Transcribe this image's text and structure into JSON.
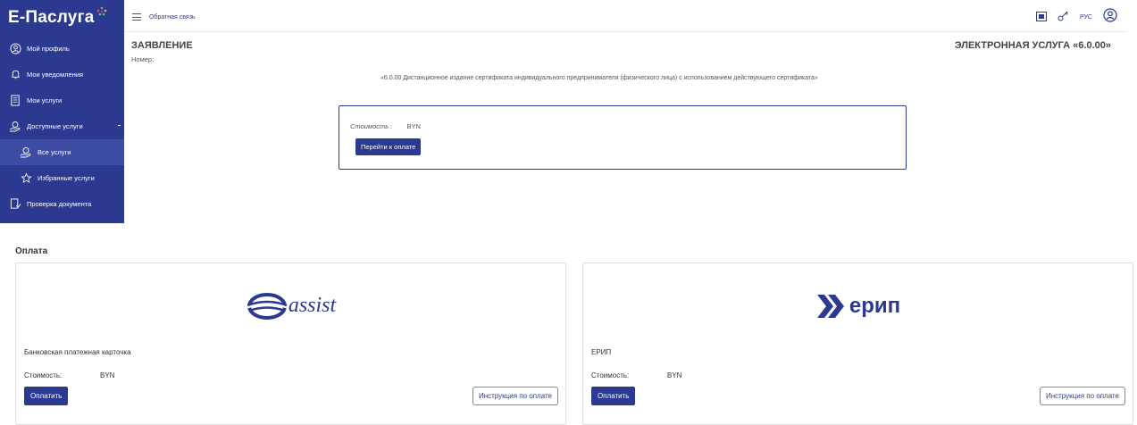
{
  "app": {
    "brand": "Е-Паслуга",
    "header": {
      "feedback_label": "Обратная связь",
      "language": "РУС"
    },
    "sidebar": {
      "items": [
        {
          "label": "Мой профиль",
          "icon": "user-circle-icon"
        },
        {
          "label": "Мои уведомления",
          "icon": "bell-icon"
        },
        {
          "label": "Мои услуги",
          "icon": "document-icon"
        },
        {
          "label": "Доступные услуги",
          "icon": "hand-service-icon"
        },
        {
          "label": "Все услуги",
          "icon": "hand-service-icon"
        },
        {
          "label": "Избранные услуги",
          "icon": "star-icon"
        },
        {
          "label": "Проверка документа",
          "icon": "document-check-icon"
        }
      ]
    },
    "statement": {
      "title": "ЗАЯВЛЕНИЕ",
      "number_label": "Номер:",
      "service_version": "ЭЛЕКТРОННАЯ УСЛУГА «6.0.00»",
      "description": "«6.0.00 Дистанционное издание сертификата индивидуального предпринимателя (физического лица) с использованием действующего сертификата»"
    },
    "payment_card": {
      "cost_label": "Стоимость :",
      "currency": "BYN",
      "button": "Перейти к оплате"
    }
  },
  "payment": {
    "title": "Оплата",
    "methods": [
      {
        "logo": "assist",
        "name": "Банковская платежная карточка",
        "cost_label": "Стоимость:",
        "currency": "BYN",
        "pay_button": "Оплатить",
        "instruction_button": "Инструкция по оплате"
      },
      {
        "logo": "ерип",
        "name": "ЕРИП",
        "cost_label": "Стоимость:",
        "currency": "BYN",
        "pay_button": "Оплатить",
        "instruction_button": "Инструкция по оплате"
      }
    ]
  },
  "colors": {
    "brand_blue": "#2b3990",
    "sidebar_active": "#3d4da6",
    "border": "#dddddd"
  }
}
